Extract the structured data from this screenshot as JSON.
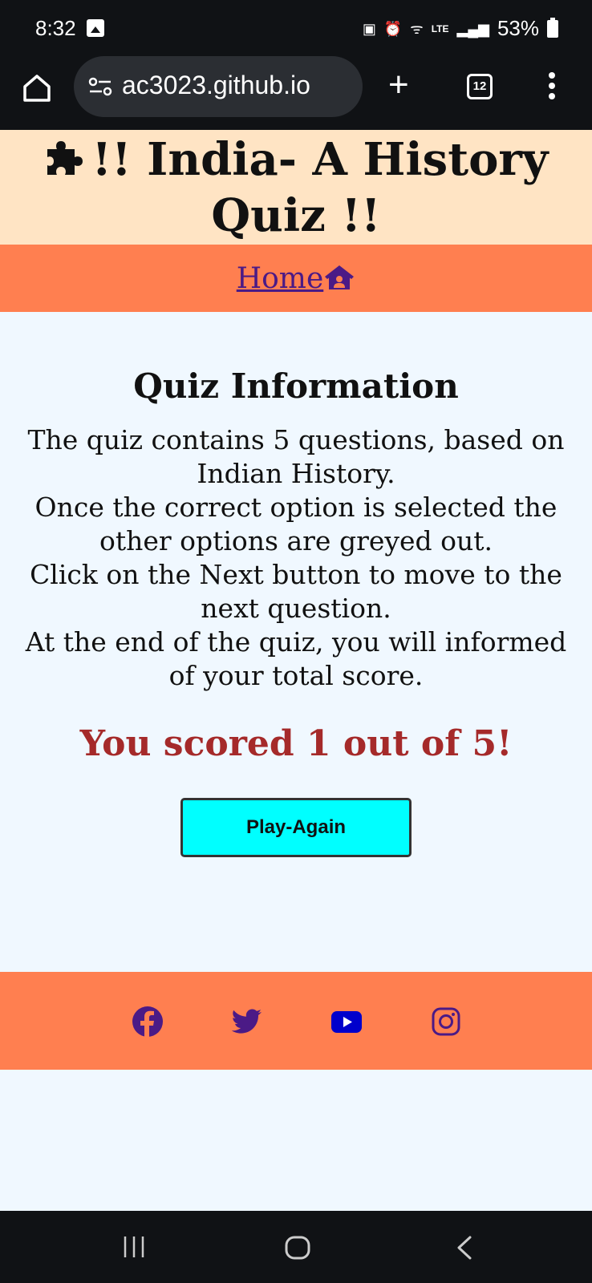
{
  "status_bar": {
    "time": "8:32",
    "battery_percent": "53%",
    "network_label": "LTE"
  },
  "browser": {
    "url": "ac3023.github.io",
    "tab_count": "12"
  },
  "header": {
    "title": "!! India- A History Quiz !!"
  },
  "nav": {
    "home_label": "Home"
  },
  "main": {
    "heading": "Quiz Information",
    "info_lines": [
      "The quiz contains 5 questions, based on Indian History.",
      "Once the correct option is selected the other options are greyed out.",
      "Click on the Next button to move to the next question.",
      "At the end of the quiz, you will informed of your total score."
    ],
    "score_text": "You scored 1 out of 5!",
    "play_again_label": "Play-Again"
  },
  "footer": {
    "social": [
      "facebook-icon",
      "twitter-icon",
      "youtube-icon",
      "instagram-icon"
    ]
  },
  "colors": {
    "header_bg": "#ffe4c4",
    "nav_bg": "#ff7f50",
    "page_bg": "#f0f8ff",
    "score": "#a52a2a",
    "button_bg": "#00ffff",
    "link": "#4b1a86"
  }
}
